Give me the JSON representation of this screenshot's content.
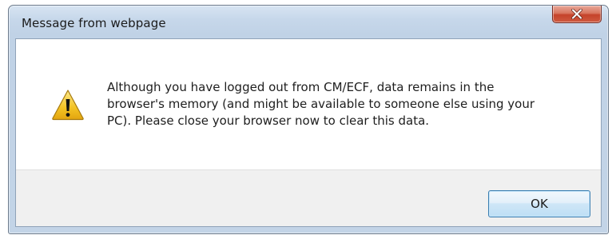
{
  "dialog": {
    "title": "Message from webpage",
    "close_icon": "close-icon",
    "icon": "warning-icon",
    "message_lines": [
      "Although you have logged out from CM/ECF, data remains in the",
      "browser's memory (and might be available to someone else using your",
      "PC). Please close your browser now to clear this data."
    ],
    "ok_label": "OK"
  },
  "colors": {
    "title_bar": "#c6d7ea",
    "close_button": "#c5432b",
    "warning_yellow": "#f3c224",
    "button_area": "#f0f0f0",
    "ok_border": "#3c7fb1"
  }
}
